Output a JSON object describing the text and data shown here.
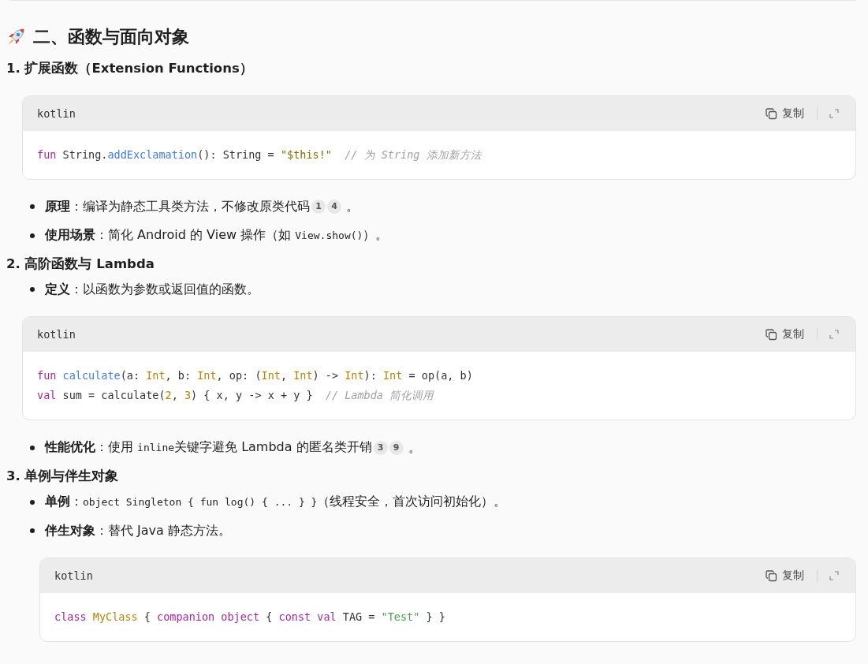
{
  "heading": {
    "text": "二、函数与面向对象"
  },
  "blocks": [
    {
      "kind": "subheading",
      "text": "1. 扩展函数（Extension Functions）"
    },
    {
      "kind": "code",
      "indent": false,
      "language": "kotlin",
      "copy": "复制",
      "lines": [
        [
          {
            "kind": "kw",
            "text": "fun"
          },
          {
            "kind": "plain",
            "text": " String."
          },
          {
            "kind": "fn",
            "text": "addExclamation"
          },
          {
            "kind": "plain",
            "text": "(): String = "
          },
          {
            "kind": "str",
            "text": "\"$this!\"  "
          },
          {
            "kind": "comment",
            "text": "// 为 String 添加新方法"
          }
        ]
      ]
    },
    {
      "kind": "bullet",
      "label": "原理",
      "segments": [
        {
          "kind": "text",
          "text": "：编译为静态工具类方法，不修改原类代码"
        }
      ],
      "citations": [
        "1",
        "4"
      ],
      "tail": "。"
    },
    {
      "kind": "bullet",
      "label": "使用场景",
      "segments": [
        {
          "kind": "text",
          "text": "：简化 Android 的 View 操作（如 "
        },
        {
          "kind": "code",
          "text": "View.show()"
        },
        {
          "kind": "text",
          "text": "）。"
        }
      ]
    },
    {
      "kind": "subheading",
      "text": "2. 高阶函数与 Lambda"
    },
    {
      "kind": "bullet",
      "label": "定义",
      "segments": [
        {
          "kind": "text",
          "text": "：以函数为参数或返回值的函数。"
        }
      ]
    },
    {
      "kind": "code",
      "indent": false,
      "language": "kotlin",
      "copy": "复制",
      "lines": [
        [
          {
            "kind": "kw",
            "text": "fun "
          },
          {
            "kind": "fn",
            "text": "calculate"
          },
          {
            "kind": "plain",
            "text": "(a: "
          },
          {
            "kind": "type",
            "text": "Int"
          },
          {
            "kind": "plain",
            "text": ", b: "
          },
          {
            "kind": "type",
            "text": "Int"
          },
          {
            "kind": "plain",
            "text": ", op: ("
          },
          {
            "kind": "type",
            "text": "Int"
          },
          {
            "kind": "plain",
            "text": ", "
          },
          {
            "kind": "type",
            "text": "Int"
          },
          {
            "kind": "plain",
            "text": ") -> "
          },
          {
            "kind": "type",
            "text": "Int"
          },
          {
            "kind": "plain",
            "text": "): "
          },
          {
            "kind": "type",
            "text": "Int"
          },
          {
            "kind": "plain",
            "text": " = op(a, b)"
          }
        ],
        [
          {
            "kind": "kw",
            "text": "val"
          },
          {
            "kind": "plain",
            "text": " sum = calculate("
          },
          {
            "kind": "type",
            "text": "2"
          },
          {
            "kind": "plain",
            "text": ", "
          },
          {
            "kind": "type",
            "text": "3"
          },
          {
            "kind": "plain",
            "text": ") { x, y -> x + y }  "
          },
          {
            "kind": "comment",
            "text": "// Lambda 简化调用"
          }
        ]
      ]
    },
    {
      "kind": "bullet",
      "label": "性能优化",
      "segments": [
        {
          "kind": "text",
          "text": "：使用 "
        },
        {
          "kind": "code",
          "text": "inline"
        },
        {
          "kind": "text",
          "text": "关键字避免 Lambda 的匿名类开销"
        }
      ],
      "citations": [
        "3",
        "9"
      ],
      "tail": "。"
    },
    {
      "kind": "subheading",
      "text": "3. 单例与伴生对象"
    },
    {
      "kind": "bullet",
      "label": "单例",
      "segments": [
        {
          "kind": "text",
          "text": "："
        },
        {
          "kind": "code",
          "text": "object Singleton { fun log() { ... } }"
        },
        {
          "kind": "text",
          "text": "（线程安全，首次访问初始化）。"
        }
      ]
    },
    {
      "kind": "bullet",
      "label": "伴生对象",
      "segments": [
        {
          "kind": "text",
          "text": "：替代 Java 静态方法。"
        }
      ]
    },
    {
      "kind": "code",
      "indent": true,
      "language": "kotlin",
      "copy": "复制",
      "lines": [
        [
          {
            "kind": "kw",
            "text": "class "
          },
          {
            "kind": "type",
            "text": "MyClass"
          },
          {
            "kind": "plain",
            "text": " { "
          },
          {
            "kind": "kw",
            "text": "companion object"
          },
          {
            "kind": "plain",
            "text": " { "
          },
          {
            "kind": "kw",
            "text": "const val"
          },
          {
            "kind": "plain",
            "text": " TAG = "
          },
          {
            "kind": "str2",
            "text": "\"Test\""
          },
          {
            "kind": "plain",
            "text": " } }"
          }
        ]
      ]
    }
  ]
}
